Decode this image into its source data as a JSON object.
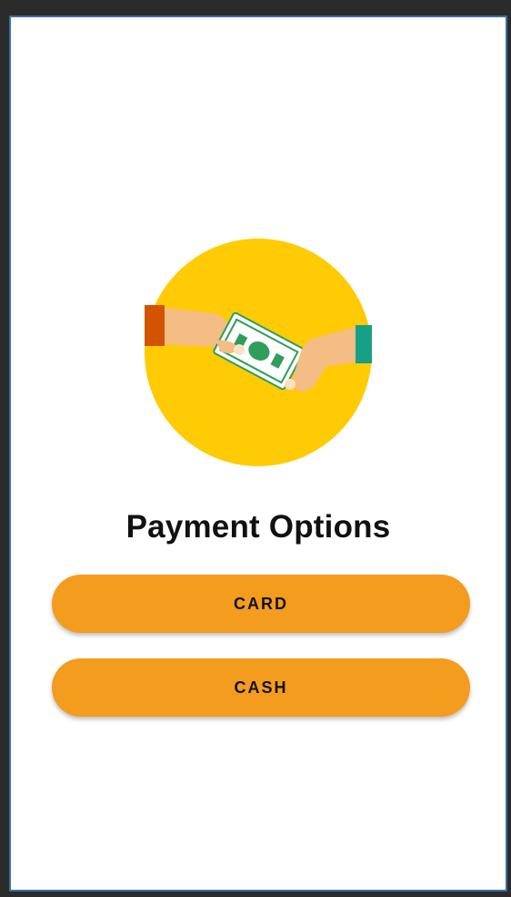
{
  "screen": {
    "title": "Payment Options",
    "illustration_icon": "hands-exchanging-money-icon"
  },
  "options": {
    "card_label": "CARD",
    "cash_label": "CASH"
  },
  "colors": {
    "button_background": "#f49c1e",
    "illustration_circle": "#ffcb05",
    "banknote": "#2e9e5b",
    "left_sleeve": "#d35400",
    "right_sleeve": "#17a085",
    "skin": "#f3bd84",
    "frame_border": "#3a6fa8"
  }
}
